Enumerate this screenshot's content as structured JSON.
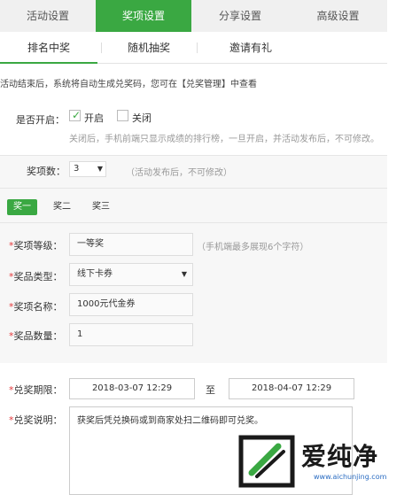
{
  "top_tabs": [
    "活动设置",
    "奖项设置",
    "分享设置",
    "高级设置"
  ],
  "sub_tabs": [
    "排名中奖",
    "随机抽奖",
    "邀请有礼"
  ],
  "notice": "活动结束后，系统将自动生成兑奖码，您可在【兑奖管理】中查看",
  "enable": {
    "label": "是否开启：",
    "on": "开启",
    "off": "关闭",
    "hint": "关闭后，手机前端只显示成绩的排行榜，一旦开启，并活动发布后，不可修改。"
  },
  "prize_count": {
    "label": "奖项数：",
    "value": "3",
    "hint": "（活动发布后，不可修改）"
  },
  "prize_tabs": [
    "奖一",
    "奖二",
    "奖三"
  ],
  "fields": {
    "level": {
      "label": "奖项等级：",
      "value": "一等奖",
      "hint": "（手机端最多展现6个字符）"
    },
    "type": {
      "label": "奖品类型：",
      "value": "线下卡券"
    },
    "name": {
      "label": "奖项名称：",
      "value": "1000元代金券"
    },
    "qty": {
      "label": "奖品数量：",
      "value": "1"
    }
  },
  "redeem": {
    "label": "兑奖期限：",
    "start": "2018-03-07 12:29",
    "to": "至",
    "end": "2018-04-07 12:29"
  },
  "desc": {
    "label": "兑奖说明：",
    "value": "获奖后凭兑换码或到商家处扫二维码即可兑奖。"
  },
  "watermark": {
    "text": "爱纯净",
    "url": "www.aichunjing.com"
  },
  "colors": {
    "accent": "#3aa842",
    "required": "#e4393c"
  }
}
